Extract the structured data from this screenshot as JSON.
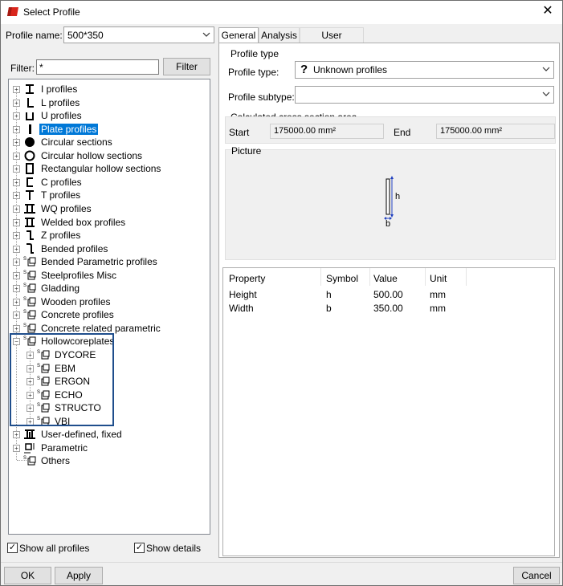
{
  "window": {
    "title": "Select Profile"
  },
  "profile_name": {
    "label": "Profile name:",
    "value": "500*350"
  },
  "filter": {
    "label": "Filter:",
    "value": "*",
    "button_label": "Filter"
  },
  "tree": {
    "items": [
      {
        "label": "I profiles",
        "icon": "i-profile-icon"
      },
      {
        "label": "L profiles",
        "icon": "l-profile-icon"
      },
      {
        "label": "U profiles",
        "icon": "u-profile-icon"
      },
      {
        "label": "Plate profiles",
        "icon": "plate-profile-icon",
        "selected": true
      },
      {
        "label": "Circular sections",
        "icon": "circle-filled-icon"
      },
      {
        "label": "Circular hollow sections",
        "icon": "circle-hollow-icon"
      },
      {
        "label": "Rectangular hollow sections",
        "icon": "rect-hollow-icon"
      },
      {
        "label": "C profiles",
        "icon": "c-profile-icon"
      },
      {
        "label": "T profiles",
        "icon": "t-profile-icon"
      },
      {
        "label": "WQ profiles",
        "icon": "wq-profile-icon"
      },
      {
        "label": "Welded box profiles",
        "icon": "welded-box-icon"
      },
      {
        "label": "Z profiles",
        "icon": "z-profile-icon"
      },
      {
        "label": "Bended profiles",
        "icon": "bended-profile-icon"
      },
      {
        "label": "Bended Parametric profiles",
        "icon": "parametric-profile-icon"
      },
      {
        "label": "Steelprofiles Misc",
        "icon": "parametric-profile-icon"
      },
      {
        "label": "Gladding",
        "icon": "parametric-profile-icon"
      },
      {
        "label": "Wooden profiles",
        "icon": "parametric-profile-icon"
      },
      {
        "label": "Concrete profiles",
        "icon": "parametric-profile-icon"
      },
      {
        "label": "Concrete related parametric",
        "icon": "parametric-profile-icon"
      },
      {
        "label": "Hollowcoreplates",
        "icon": "parametric-profile-icon",
        "expanded": true
      },
      {
        "label": "DYCORE",
        "icon": "parametric-profile-icon",
        "child": true
      },
      {
        "label": "EBM",
        "icon": "parametric-profile-icon",
        "child": true
      },
      {
        "label": "ERGON",
        "icon": "parametric-profile-icon",
        "child": true
      },
      {
        "label": "ECHO",
        "icon": "parametric-profile-icon",
        "child": true
      },
      {
        "label": "STRUCTO",
        "icon": "parametric-profile-icon",
        "child": true
      },
      {
        "label": "VBI",
        "icon": "parametric-profile-icon",
        "child": true
      },
      {
        "label": "User-defined, fixed",
        "icon": "user-defined-icon"
      },
      {
        "label": "Parametric",
        "icon": "parametric-icon"
      },
      {
        "label": "Others",
        "icon": "parametric-profile-icon",
        "no_expander": true
      }
    ]
  },
  "checkboxes": {
    "show_all_profiles": {
      "label": "Show all profiles",
      "checked": true
    },
    "show_details": {
      "label": "Show details",
      "checked": true
    }
  },
  "tabs": [
    "General",
    "Analysis",
    "User attributes"
  ],
  "general": {
    "profile_type_group": "Profile type",
    "profile_type_label": "Profile type:",
    "profile_type_icon": "?",
    "profile_type_value": "Unknown profiles",
    "profile_subtype_label": "Profile subtype:",
    "profile_subtype_value": "",
    "cross_section_group": "Calculated cross section area",
    "start_label": "Start",
    "start_value": "175000.00 mm²",
    "end_label": "End",
    "end_value": "175000.00 mm²",
    "picture_group": "Picture",
    "picture_h": "h",
    "picture_b": "b"
  },
  "properties_table": {
    "headers": [
      "Property",
      "Symbol",
      "Value",
      "Unit"
    ],
    "rows": [
      [
        "Height",
        "h",
        "500.00",
        "mm"
      ],
      [
        "Width",
        "b",
        "350.00",
        "mm"
      ]
    ]
  },
  "footer": {
    "ok_label": "OK",
    "apply_label": "Apply",
    "cancel_label": "Cancel"
  },
  "colors": {
    "selection": "#0078d7",
    "highlight_border": "#1f4e8c",
    "dimension_lines": "#1f3fbf"
  }
}
